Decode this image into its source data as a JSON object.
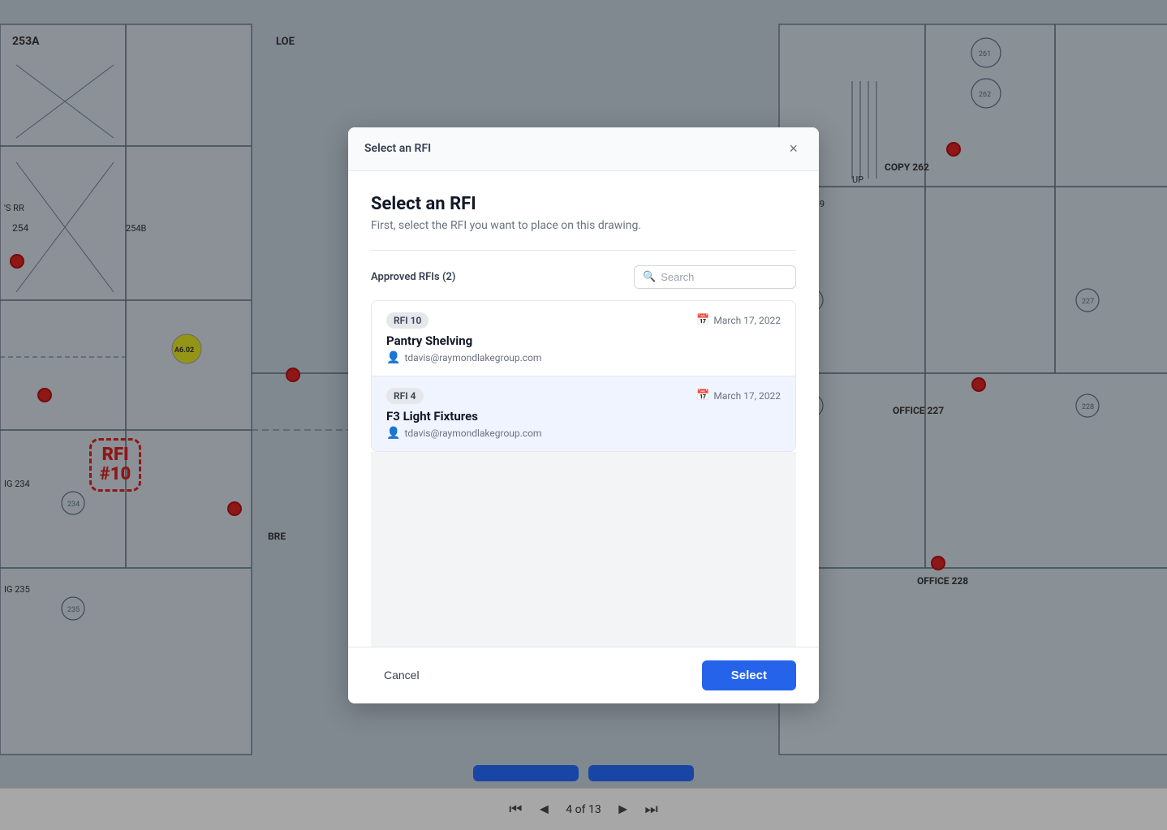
{
  "modal": {
    "header_title": "Select an RFI",
    "close_label": "×",
    "title": "Select an RFI",
    "subtitle": "First, select the RFI you want to place on this drawing.",
    "section_label": "Approved RFIs (2)",
    "search_placeholder": "Search",
    "rfis": [
      {
        "badge": "RFI 10",
        "date": "March 17, 2022",
        "name": "Pantry Shelving",
        "user": "tdavis@raymondlakegroup.com"
      },
      {
        "badge": "RFI 4",
        "date": "March 17, 2022",
        "name": "F3 Light Fixtures",
        "user": "tdavis@raymondlakegroup.com"
      }
    ],
    "cancel_label": "Cancel",
    "select_label": "Select"
  },
  "nav": {
    "page_indicator": "4 of 13"
  },
  "rfi_marker": {
    "line1": "RFI",
    "line2": "#10"
  }
}
